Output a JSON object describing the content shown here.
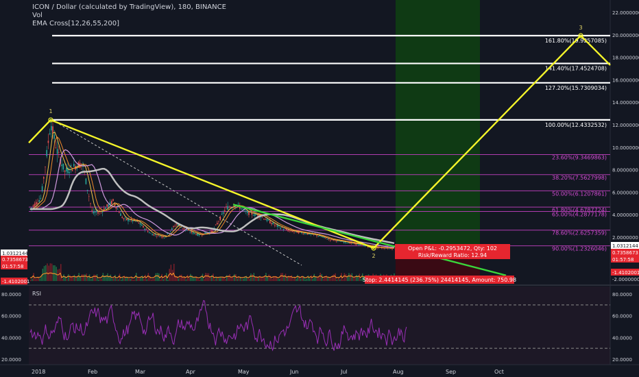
{
  "header": {
    "symbol_line": "ICON / Dollar (calculated by TradingView), 180, BINANCE",
    "vol_label": "Vol",
    "ema_label": "EMA Cross[12,26,55,200]"
  },
  "colors": {
    "background": "#131722",
    "yellow_line": "#f5f52a",
    "green_line": "#3bd63b",
    "fib_white": "#ffffff",
    "fib_magenta": "#b03cb0",
    "rsi_line": "#9b2fb8",
    "green_zone": "#0f3a14",
    "red_zone": "#3a0a14",
    "label_red": "#e5262f"
  },
  "chart_data": {
    "type": "line",
    "title": "ICON / Dollar (calculated by TradingView), 180, BINANCE",
    "price_axis": {
      "ticks": [
        "22.0000000",
        "20.0000000",
        "18.0000000",
        "16.0000000",
        "14.0000000",
        "12.0000000",
        "10.0000000",
        "8.0000000",
        "6.0000000",
        "4.0000000",
        "2.0000000"
      ],
      "ylim": [
        0,
        22
      ]
    },
    "time_axis": {
      "ticks": [
        "2018",
        "Feb",
        "Mar",
        "Apr",
        "May",
        "Jun",
        "Jul",
        "Aug",
        "Sep",
        "Oct"
      ]
    },
    "fib_levels": [
      {
        "label": "161.80%(19.9257085)",
        "value": 19.9257085,
        "color": "white"
      },
      {
        "label": "141.40%(17.4524708)",
        "value": 17.4524708,
        "color": "white"
      },
      {
        "label": "127.20%(15.7309034)",
        "value": 15.7309034,
        "color": "white"
      },
      {
        "label": "100.00%(12.4332532)",
        "value": 12.4332532,
        "color": "white"
      },
      {
        "label": "23.60%(9.3469863)",
        "value": 9.3469863,
        "color": "magenta"
      },
      {
        "label": "38.20%(7.5627998)",
        "value": 7.5627998,
        "color": "magenta"
      },
      {
        "label": "50.00%(6.1207861)",
        "value": 6.1207861,
        "color": "magenta"
      },
      {
        "label": "61.80%(4.6787724)",
        "value": 4.6787724,
        "color": "magenta"
      },
      {
        "label": "65.00%(4.2877178)",
        "value": 4.2877178,
        "color": "magenta"
      },
      {
        "label": "78.60%(2.6257359)",
        "value": 2.6257359,
        "color": "magenta"
      },
      {
        "label": "90.00%(1.2326046)",
        "value": 1.2326046,
        "color": "magenta"
      }
    ],
    "wave_points": [
      {
        "label": "1",
        "value": 12.43
      },
      {
        "label": "2",
        "value": 1.03
      },
      {
        "label": "3",
        "value": 19.93
      }
    ],
    "right_labels": [
      {
        "text": "1.0312144",
        "value": 1.0312144,
        "bg": "#ffffff",
        "fg": "#131722"
      },
      {
        "text": "0.7358673",
        "value": 0.7358673,
        "bg": "#e5262f",
        "fg": "#ffffff"
      },
      {
        "text": "01:57:58",
        "value": 0.45,
        "bg": "#e5262f",
        "fg": "#ffffff"
      },
      {
        "text": "-1.4102001",
        "value": -1.4102001,
        "bg": "#e5262f",
        "fg": "#ffffff"
      },
      {
        "text": "-2.0000000",
        "value": -2.0,
        "bg": "none",
        "fg": "#d1d4dc"
      }
    ],
    "left_labels": [
      {
        "text": "1.0312144",
        "bg": "#ffffff",
        "fg": "#131722"
      },
      {
        "text": "0.7358673",
        "bg": "#e5262f",
        "fg": "#ffffff"
      },
      {
        "text": "01:57:58",
        "bg": "#e5262f",
        "fg": "#ffffff"
      },
      {
        "text": "-1.4102001",
        "bg": "#e5262f",
        "fg": "#ffffff"
      }
    ],
    "position_box": {
      "pnl_text": "Open P&L: -0.2953472, Qty: 102",
      "ratio_text": "Risk/Reward Ratio: 12.94",
      "stop_text": "Stop: 2.4414145 (236.75%) 24414145, Amount: 750.98"
    },
    "rsi": {
      "label": "RSI",
      "ticks": [
        "80.0000",
        "60.0000",
        "40.0000",
        "20.0000"
      ],
      "right_ticks": [
        "80.0000",
        "60.0000",
        "40.0000",
        "20.0000"
      ],
      "upper_band": 70,
      "lower_band": 30,
      "ylim": [
        10,
        90
      ]
    }
  }
}
